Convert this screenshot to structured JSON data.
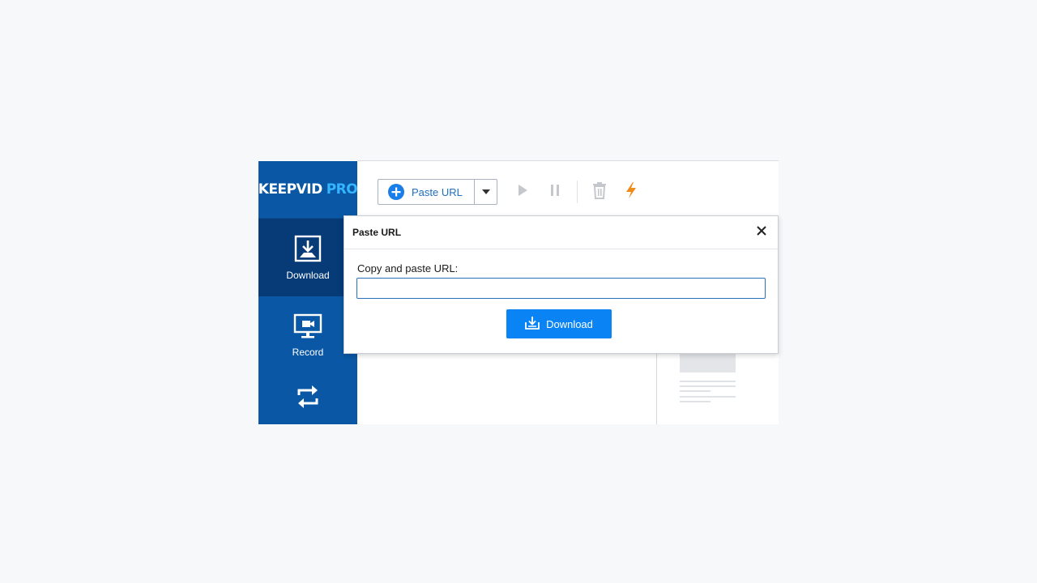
{
  "app": {
    "logo_main": "KEEPVID",
    "logo_accent": "PRO",
    "accent_color": "#0a58a5",
    "brand_light": "#35b4ff"
  },
  "sidebar": {
    "items": [
      {
        "label": "Download",
        "icon": "download-icon",
        "active": true
      },
      {
        "label": "Record",
        "icon": "record-screen-icon",
        "active": false
      },
      {
        "label": "",
        "icon": "convert-icon",
        "active": false
      }
    ]
  },
  "toolbar": {
    "paste_url_label": "Paste URL",
    "icons": [
      "plus-circle-icon",
      "chevron-down-icon",
      "play-icon",
      "pause-icon",
      "trash-icon",
      "lightning-icon"
    ],
    "lightning_color": "#f08a18"
  },
  "dialog": {
    "title": "Paste URL",
    "field_label": "Copy and paste URL:",
    "url_value": "",
    "download_label": "Download",
    "button_color": "#0a84f5"
  }
}
